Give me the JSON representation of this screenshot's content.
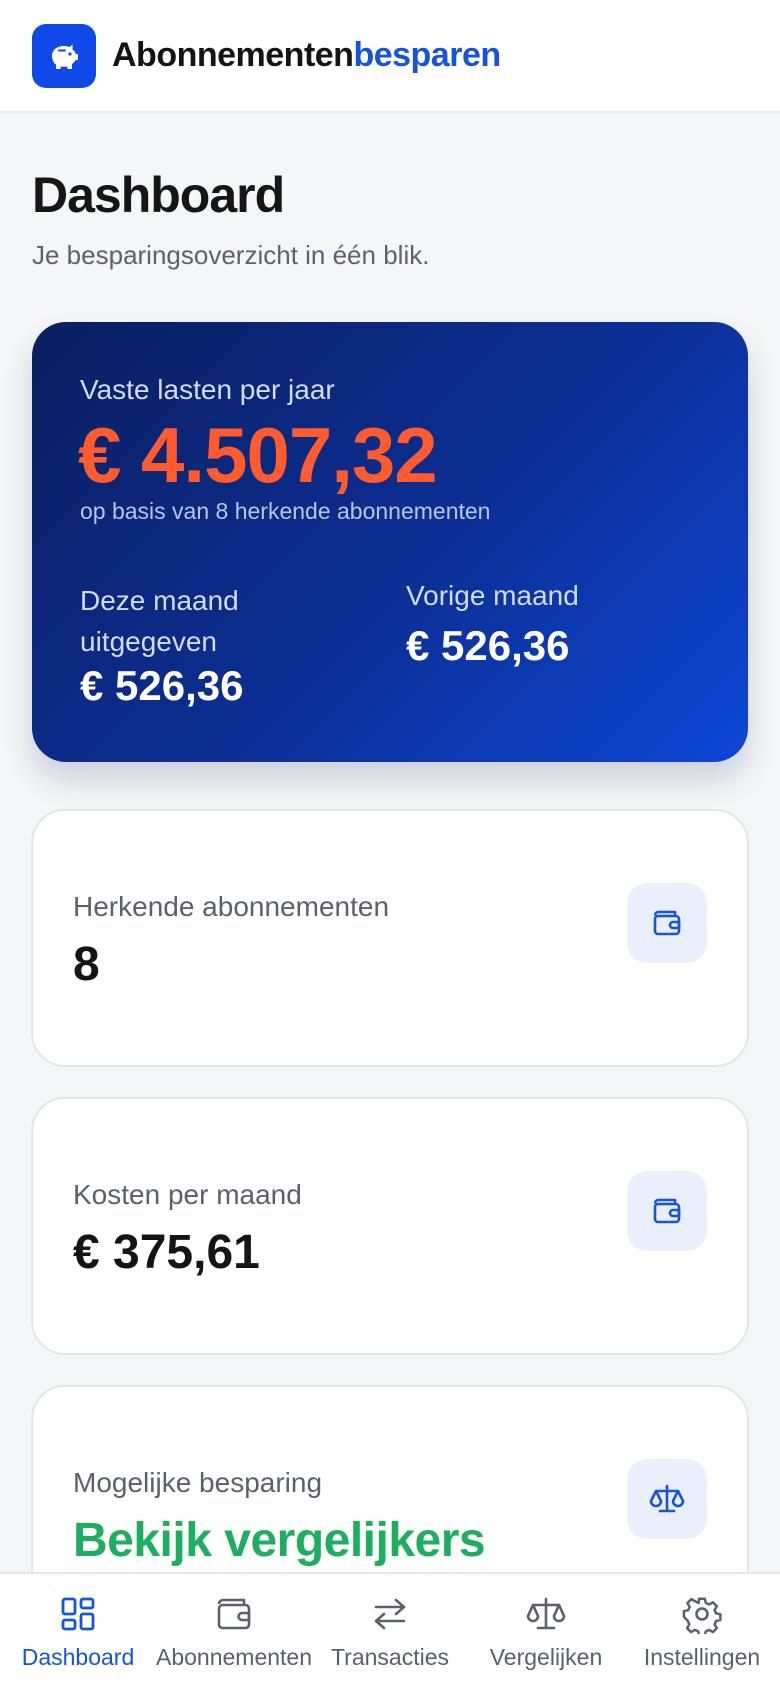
{
  "brand": {
    "part1": "Abonnementen",
    "part2": "besparen",
    "icon": "piggy-bank-icon"
  },
  "page": {
    "title": "Dashboard",
    "subtitle": "Je besparingsoverzicht in één blik."
  },
  "hero": {
    "label": "Vaste lasten per jaar",
    "amount": "€ 4.507,32",
    "basis": "op basis van 8 herkende abonnementen",
    "this_month_label": "Deze maand uitgegeven",
    "this_month_value": "€ 526,36",
    "prev_month_label": "Vorige maand",
    "prev_month_value": "€ 526,36"
  },
  "cards": [
    {
      "label": "Herkende abonnementen",
      "value": "8",
      "icon": "wallet-icon"
    },
    {
      "label": "Kosten per maand",
      "value": "€ 375,61",
      "icon": "wallet-icon"
    },
    {
      "label": "Mogelijke besparing",
      "value": "Bekijk vergelijkers",
      "icon": "scale-icon"
    }
  ],
  "nav": [
    {
      "label": "Dashboard",
      "icon": "dashboard-grid-icon",
      "active": true
    },
    {
      "label": "Abonnementen",
      "icon": "wallet-icon",
      "active": false
    },
    {
      "label": "Transacties",
      "icon": "arrows-swap-icon",
      "active": false
    },
    {
      "label": "Vergelijken",
      "icon": "scale-icon",
      "active": false
    },
    {
      "label": "Instellingen",
      "icon": "gear-icon",
      "active": false
    }
  ],
  "colors": {
    "accent": "#1653de",
    "hero_amount": "#ff5b2e",
    "savings": "#1dae5f"
  }
}
